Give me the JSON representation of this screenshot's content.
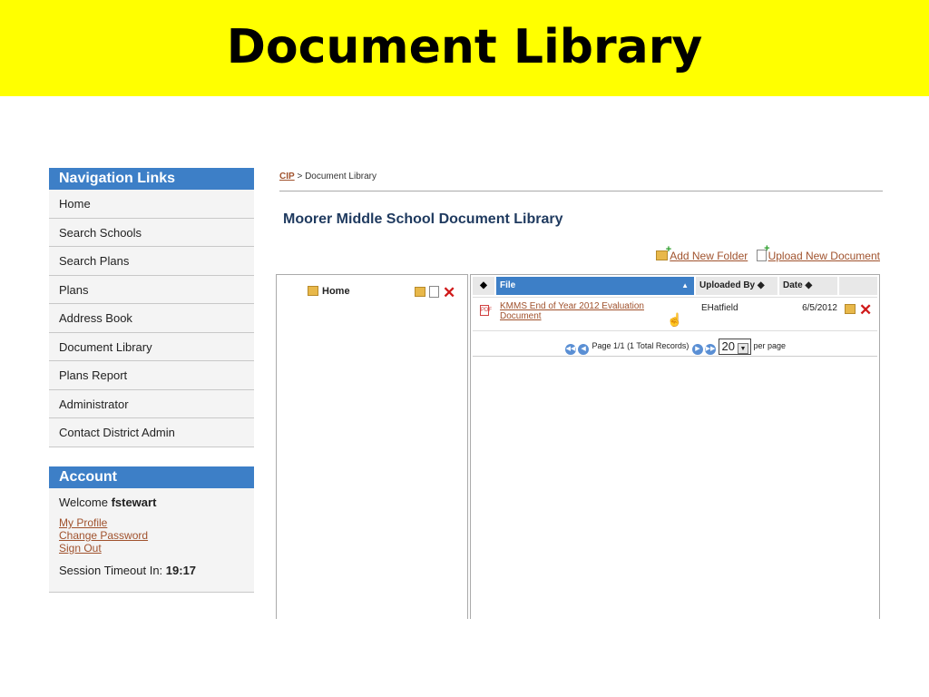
{
  "banner": {
    "title": "Document Library"
  },
  "nav": {
    "heading": "Navigation Links",
    "items": [
      "Home",
      "Search Schools",
      "Search Plans",
      "Plans",
      "Address Book",
      "Document Library",
      "Plans Report",
      "Administrator",
      "Contact District Admin"
    ]
  },
  "account": {
    "heading": "Account",
    "welcome_prefix": "Welcome ",
    "username": "fstewart",
    "links": [
      "My Profile",
      "Change Password",
      "Sign Out"
    ],
    "session_label": "Session Timeout In: ",
    "session_value": "19:17"
  },
  "breadcrumb": {
    "root": "CIP",
    "separator": " > ",
    "current": "Document Library"
  },
  "page_title": "Moorer Middle School Document Library",
  "actions": {
    "add_folder": "Add New Folder",
    "upload": "Upload New Document"
  },
  "tree": {
    "root_label": "Home"
  },
  "grid": {
    "columns": {
      "sort": "◆",
      "file": "File",
      "uploaded_by": "Uploaded By ◆",
      "date": "Date   ◆"
    },
    "rows": [
      {
        "icon": "pdf-icon",
        "file": "KMMS End of Year 2012 Evaluation Document",
        "uploaded_by": "EHatfield",
        "date": "6/5/2012"
      }
    ],
    "pager": {
      "text": "Page 1/1 (1 Total Records)",
      "page_size": "20",
      "per_page": "per page"
    }
  },
  "colors": {
    "banner": "#ffff00",
    "panel_head": "#3d7fc7",
    "link": "#a0522d",
    "delete": "#d01a1a"
  }
}
